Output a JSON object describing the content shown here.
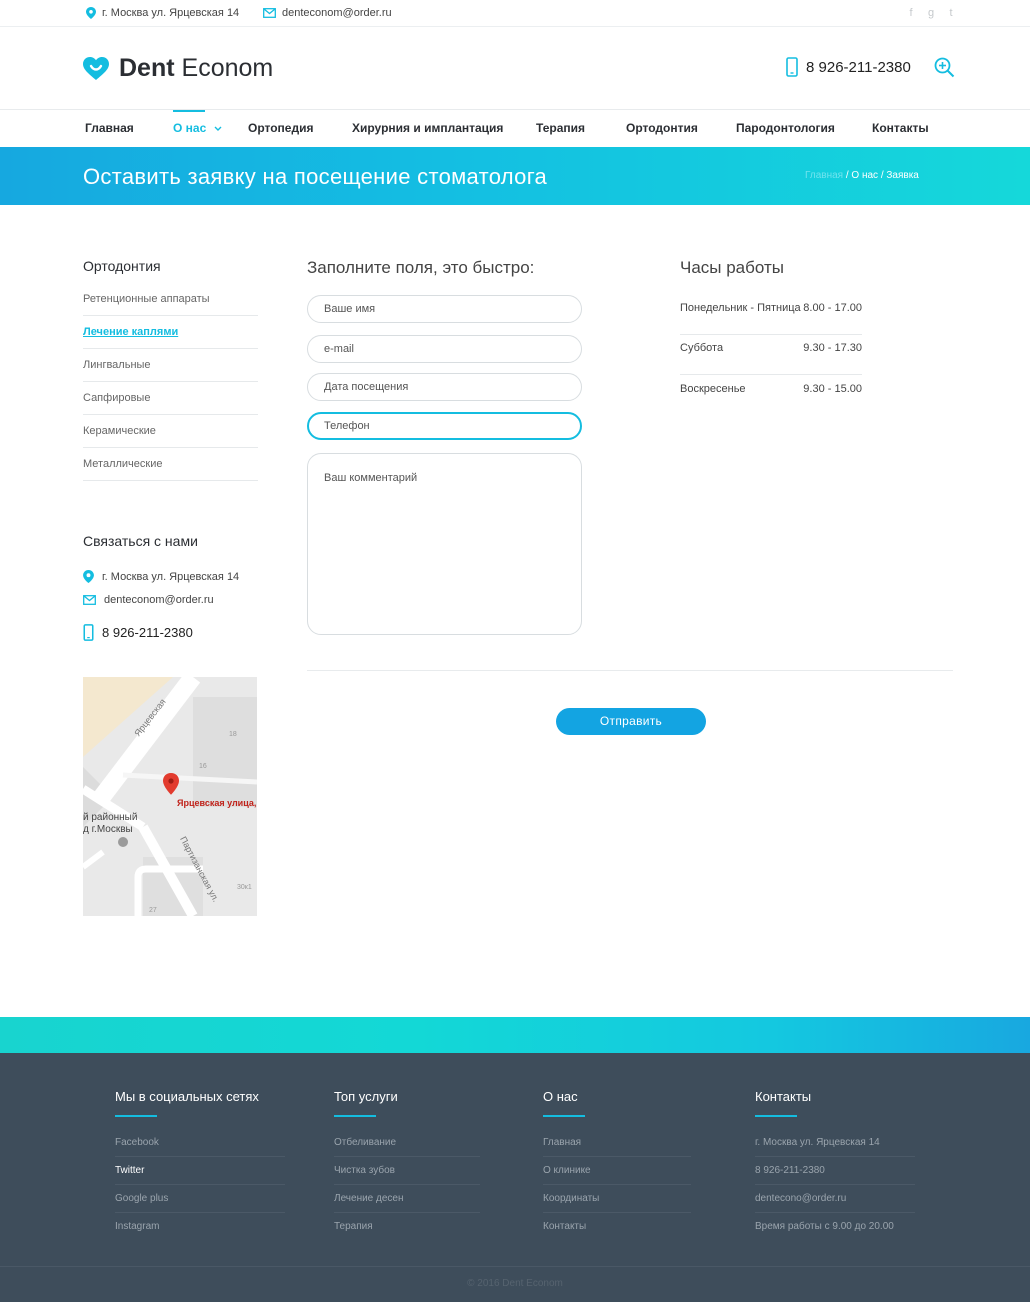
{
  "topbar": {
    "address": "г. Москва ул. Ярцевская 14",
    "email": "denteconom@order.ru",
    "socials": [
      "f",
      "g",
      "t"
    ]
  },
  "header": {
    "logo_bold": "Dent",
    "logo_light": "Econom",
    "phone": "8 926-211-2380"
  },
  "nav": {
    "items": [
      "Главная",
      "О нас",
      "Ортопедия",
      "Хирурния и имплантация",
      "Терапия",
      "Ортодонтия",
      "Пародонтология",
      "Контакты"
    ]
  },
  "banner": {
    "title": "Оставить заявку на посещение стоматолога",
    "crumb_home": "Главная",
    "crumb_rest": " / О нас / Заявка"
  },
  "sidebar": {
    "title": "Ортодонтия",
    "items": [
      "Ретенционные аппараты",
      "Лечение каплями",
      "Лингвальные",
      "Сапфировые",
      "Керамические",
      "Металлические"
    ],
    "contact_title": "Связаться с нами",
    "address": "г. Москва ул. Ярцевская 14",
    "email": "denteconom@order.ru",
    "phone": "8 926-211-2380"
  },
  "map": {
    "street1": "Ярцевская",
    "street2": "Партизанская ул.",
    "pin_label": "Ярцевская улица,",
    "district1": "й районный",
    "district2": "д г.Москвы",
    "num18": "18",
    "num16": "16",
    "num30": "30к1",
    "num27": "27"
  },
  "form": {
    "title": "Заполните поля, это быстро:",
    "name_placeholder": "Ваше имя",
    "email_placeholder": "e-mail",
    "date_placeholder": "Дата посещения",
    "phone_placeholder": "Телефон",
    "comment_placeholder": "Ваш комментарий",
    "submit": "Отправить"
  },
  "hours": {
    "title": "Часы работы",
    "rows": [
      {
        "day": "Понедельник - Пятница",
        "time": "8.00 - 17.00"
      },
      {
        "day": "Суббота",
        "time": "9.30 - 17.30"
      },
      {
        "day": "Воскресенье",
        "time": "9.30 - 15.00"
      }
    ]
  },
  "footer": {
    "col1": {
      "title": "Мы в социальных сетях",
      "links": [
        "Facebook",
        "Twitter",
        "Google plus",
        "Instagram"
      ]
    },
    "col2": {
      "title": "Топ услуги",
      "links": [
        "Отбеливание",
        "Чистка зубов",
        "Лечение десен",
        "Терапия"
      ]
    },
    "col3": {
      "title": "О нас",
      "links": [
        "Главная",
        "О клинике",
        "Координаты",
        "Контакты"
      ]
    },
    "col4": {
      "title": "Контакты",
      "links": [
        "г. Москва ул. Ярцевская 14",
        "8 926-211-2380",
        "dentecono@order.ru",
        "Время работы с 9.00 до 20.00"
      ]
    },
    "copyright": "© 2016 Dent Econom"
  },
  "colors": {
    "accent": "#14bde0",
    "button": "#13a4e2",
    "footer_bg": "#3e4d5b"
  }
}
